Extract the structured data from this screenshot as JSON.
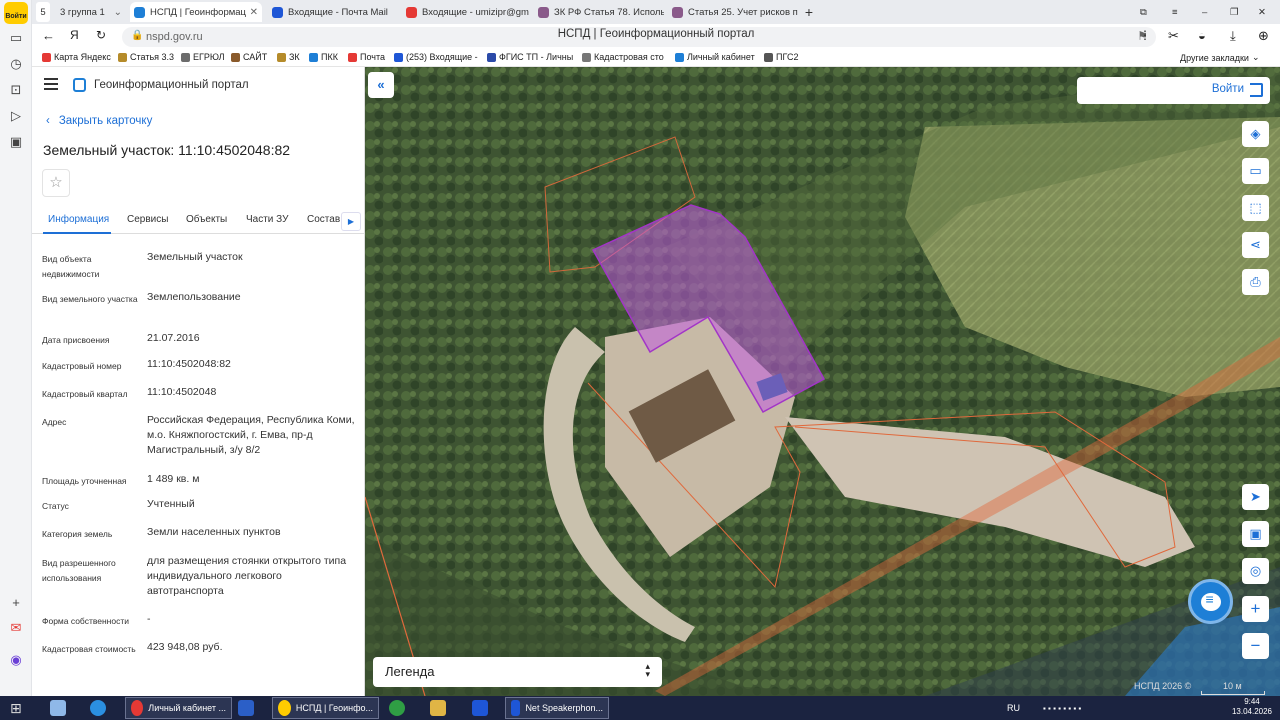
{
  "browser": {
    "tab_count": "5",
    "tabs": [
      {
        "label": "3  группа 1",
        "active": false
      },
      {
        "label": "НСПД | Геоинформац",
        "active": true
      },
      {
        "label": "Входящие - Почта Mail",
        "active": false
      },
      {
        "label": "Входящие - umizipr@gm",
        "active": false
      },
      {
        "label": "ЗК РФ Статья 78. Исполь",
        "active": false
      },
      {
        "label": "Статья 25. Учет рисков пр",
        "active": false
      }
    ],
    "url": "nspd.gov.ru",
    "page_title": "НСПД | Геоинформационный портал",
    "bookmarks": [
      {
        "label": "Карта Яндекс",
        "color": "#e53935"
      },
      {
        "label": "Статья 3.3",
        "color": "#b58b2a"
      },
      {
        "label": "ЕГРЮЛ",
        "color": "#6c6c6c"
      },
      {
        "label": "САЙТ",
        "color": "#8a5a2b"
      },
      {
        "label": "ЗК",
        "color": "#b58b2a"
      },
      {
        "label": "ПКК",
        "color": "#1e7fd6"
      },
      {
        "label": "Почта",
        "color": "#e53935"
      },
      {
        "label": "(253) Входящие -",
        "color": "#1e56d6"
      },
      {
        "label": "ФГИС ТП - Личны",
        "color": "#2b4aa8"
      },
      {
        "label": "Кадастровая сто",
        "color": "#777777"
      },
      {
        "label": "Личный кабинет",
        "color": "#1e7fd6"
      },
      {
        "label": "ПГС2",
        "color": "#555555"
      }
    ],
    "other_bookmarks": "Другие закладки",
    "yandex_logo": "Войти"
  },
  "panel": {
    "portal_title": "Геоинформационный портал",
    "close_card": "Закрыть карточку",
    "card_title": "Земельный участок: 11:10:4502048:82",
    "tabs": [
      "Информация",
      "Сервисы",
      "Объекты",
      "Части ЗУ",
      "Состав"
    ],
    "fields": [
      {
        "key": "Вид объекта недвижимости",
        "value": "Земельный участок"
      },
      {
        "key": "Вид земельного участка",
        "value": "Землепользование"
      },
      {
        "key": "Дата присвоения",
        "value": "21.07.2016"
      },
      {
        "key": "Кадастровый номер",
        "value": "11:10:4502048:82"
      },
      {
        "key": "Кадастровый квартал",
        "value": "11:10:4502048"
      },
      {
        "key": "Адрес",
        "value": "Российская Федерация, Республика Коми, м.о. Княжпогостский, г. Емва, пр-д Магистральный, з/у 8/2"
      },
      {
        "key": "Площадь уточненная",
        "value": "1 489 кв. м"
      },
      {
        "key": "Статус",
        "value": "Учтенный"
      },
      {
        "key": "Категория земель",
        "value": "Земли населенных пунктов"
      },
      {
        "key": "Вид разрешенного использования",
        "value": "для размещения стоянки открытого типа индивидуального легкового автотранспорта"
      },
      {
        "key": "Форма собственности",
        "value": "-"
      },
      {
        "key": "Кадастровая стоимость",
        "value": "423 948,08 руб."
      }
    ]
  },
  "map": {
    "login": "Войти",
    "legend": "Легенда",
    "copyright": "НСПД 2026 ©",
    "scale": "10 м",
    "tools": [
      "layers-icon",
      "ruler-icon",
      "select-area-icon",
      "share-icon",
      "print-icon"
    ],
    "nav_tools": [
      "locate-icon",
      "minimap-icon",
      "geo-icon"
    ],
    "parcel_color": "#c15be0",
    "boundary_color": "#e0693c"
  },
  "taskbar": {
    "items": [
      {
        "label": "Личный кабинет ...",
        "color": "#e53935"
      },
      {
        "label": "W",
        "color": "#2b5fc7"
      },
      {
        "label": "НСПД | Геоинфо...",
        "color": "#ffcc00"
      },
      {
        "label": "",
        "color": "#2f9e44"
      },
      {
        "label": "",
        "color": "#e0b545"
      },
      {
        "label": "",
        "color": "#1e56d6"
      },
      {
        "label": "Net Speakerphon...",
        "color": "#1e56d6"
      }
    ],
    "lang": "RU",
    "time": "9:44",
    "date": "13.04.2026"
  }
}
